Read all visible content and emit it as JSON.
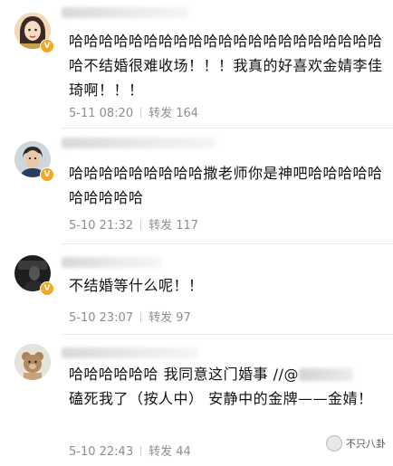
{
  "comments": [
    {
      "text": "哈哈哈哈哈哈哈哈哈哈哈哈哈哈哈哈哈哈哈哈哈哈不结婚很难收场！！！我真的好喜欢金婧李佳琦啊！！！",
      "time": "5-11 08:20",
      "repost_label": "转发",
      "repost_count": "164",
      "verified_badge": "V"
    },
    {
      "text": "哈哈哈哈哈哈哈哈哈撒老师你是神吧哈哈哈哈哈哈哈哈哈哈",
      "time": "5-10 21:32",
      "repost_label": "转发",
      "repost_count": "117",
      "verified_badge": "V"
    },
    {
      "text": "不结婚等什么呢！！",
      "time": "5-10 23:07",
      "repost_label": "转发",
      "repost_count": "97",
      "verified_badge": "V"
    },
    {
      "text_part1": "哈哈哈哈哈哈 我同意这门婚事 //@",
      "text_part2": "磕死我了（按人中） 安静中的金牌——金婧！",
      "time": "5-10 22:43",
      "repost_label": "转发",
      "repost_count": "44"
    }
  ],
  "watermark": {
    "text": "不只八卦"
  },
  "colors": {
    "badge": "#f5a623",
    "meta": "#8e8e8e",
    "divider": "#e9e9e9"
  }
}
